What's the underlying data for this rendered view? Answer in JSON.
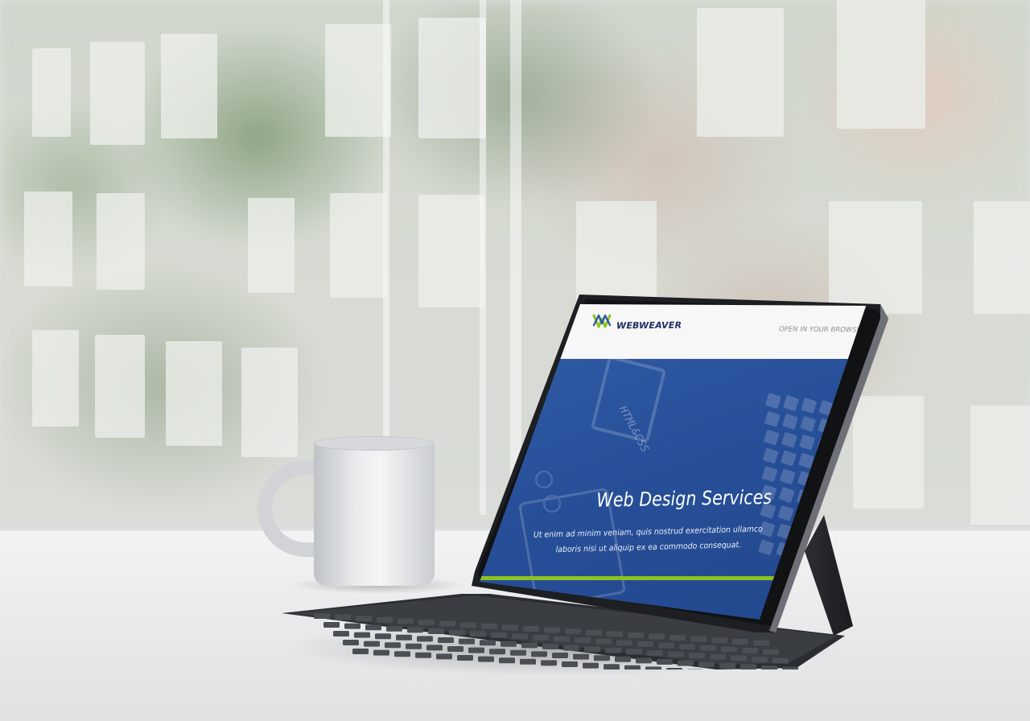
{
  "website": {
    "brand_name": "WEBWEAVER",
    "header_link": "OPEN IN YOUR BROWSER",
    "hero_title": "Web Design Services",
    "hero_text": "Ut enim ad minim veniam, quis nostrud exercitation ullamco laboris nisi ut aliquip ex ea commodo consequat.",
    "background_caption": "HTML&CSS"
  },
  "colors": {
    "hero_blue": "#274f98",
    "accent_green": "#8dc21f",
    "header_bg": "#f7f7f7",
    "brand_text": "#1f2f63"
  },
  "icons": {
    "logo": "webweaver-logo-icon"
  }
}
